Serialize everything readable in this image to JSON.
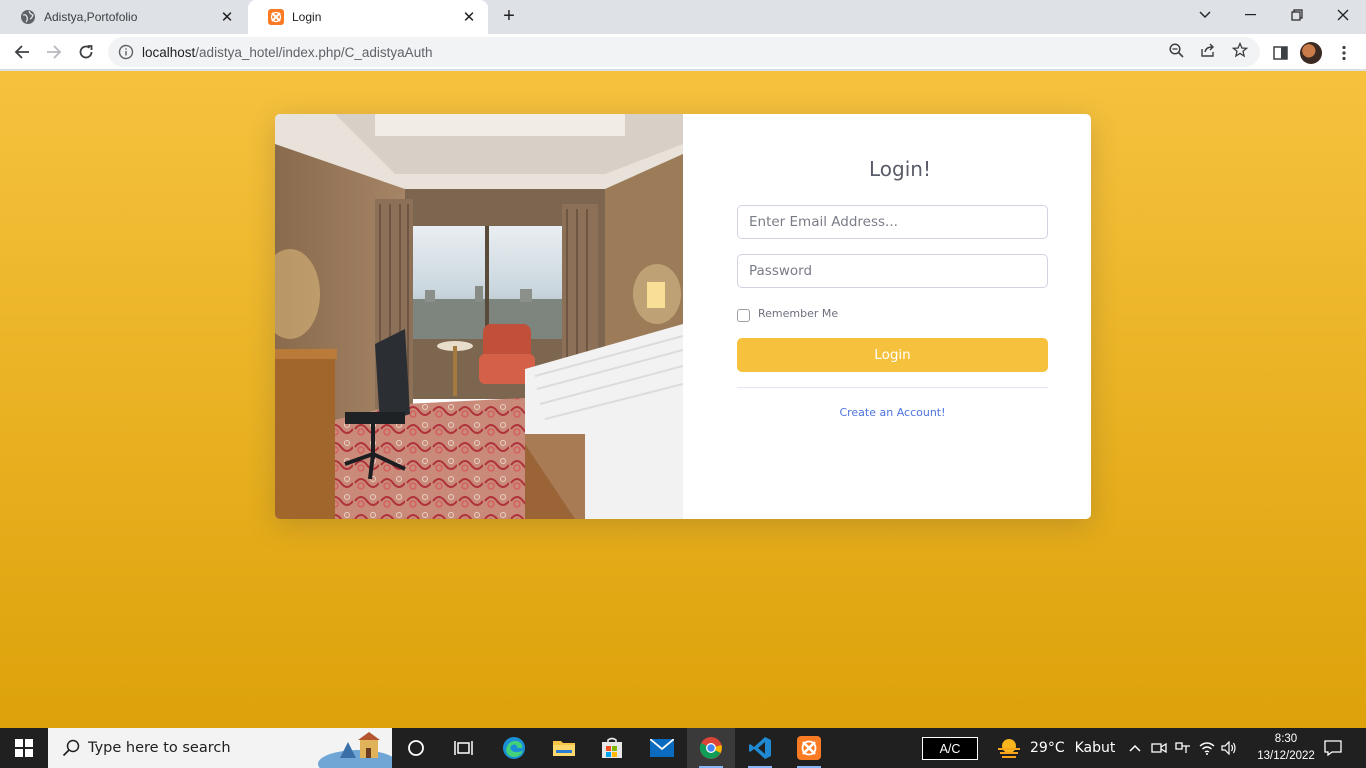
{
  "browser": {
    "tabs": [
      {
        "title": "Adistya,Portofolio",
        "favicon": "globe-icon"
      },
      {
        "title": "Login",
        "favicon": "xampp-icon",
        "active": true
      }
    ],
    "new_tab_label": "+",
    "url": {
      "host": "localhost",
      "path": "/adistya_hotel/index.php/C_adistyaAuth"
    },
    "toolbar_icons": [
      "back-icon",
      "forward-icon",
      "reload-icon",
      "site-info-icon",
      "zoom-icon",
      "share-icon",
      "star-icon",
      "side-panel-icon",
      "avatar",
      "menu-icon"
    ],
    "window_controls": [
      "tab-search-icon",
      "minimize-icon",
      "restore-icon",
      "close-icon"
    ]
  },
  "page": {
    "background_color_top": "#f6c23e",
    "background_color_bottom": "#dda20a",
    "image_alt": "hotel-room-photo",
    "login": {
      "title": "Login!",
      "email_placeholder": "Enter Email Address...",
      "password_placeholder": "Password",
      "remember_label": "Remember Me",
      "remember_checked": false,
      "button_label": "Login",
      "button_color": "#f6c23e",
      "create_account_label": "Create an Account!",
      "link_color": "#4e73df"
    }
  },
  "taskbar": {
    "search_placeholder": "Type here to search",
    "apps": [
      "cortana-icon",
      "task-view-icon",
      "edge-icon",
      "file-explorer-icon",
      "store-icon",
      "mail-icon",
      "chrome-icon",
      "vscode-icon",
      "xampp-icon"
    ],
    "ac_label": "A/C",
    "weather": {
      "temp": "29°C",
      "condition": "Kabut"
    },
    "clock": {
      "time": "8:30",
      "date": "13/12/2022"
    }
  }
}
